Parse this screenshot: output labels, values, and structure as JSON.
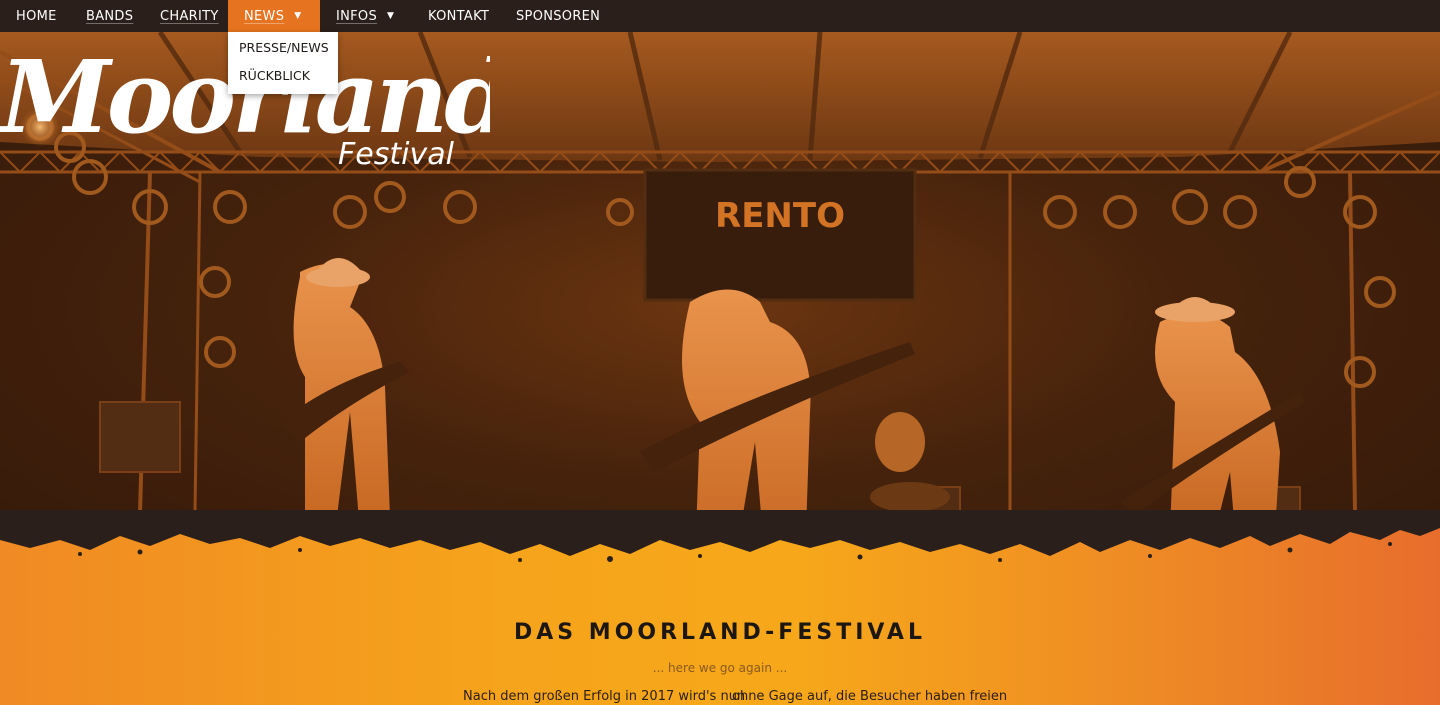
{
  "nav": {
    "items": [
      {
        "label": "HOME"
      },
      {
        "label": "BANDS"
      },
      {
        "label": "CHARITY"
      },
      {
        "label": "NEWS",
        "active": true
      },
      {
        "label": "INFOS"
      },
      {
        "label": "KONTAKT"
      },
      {
        "label": "SPONSOREN"
      }
    ],
    "news_dropdown": [
      "PRESSE/NEWS",
      "RÜCKBLICK"
    ],
    "caret_icon": "triangle-down-icon"
  },
  "hero": {
    "logo_main": "Moorland",
    "logo_sub": "Festival",
    "banner_text": "RENTO"
  },
  "section": {
    "title": "DAS MOORLAND-FESTIVAL",
    "tagline": "... here we go again ...",
    "col_left": "Nach dem großen Erfolg in 2017 wird's nun",
    "col_right": "ohne Gage auf, die Besucher haben freien"
  },
  "colors": {
    "nav_bg": "#2a1f1a",
    "accent": "#e5731f",
    "orange": "#f6a41b",
    "text_dark": "#1d1712"
  }
}
